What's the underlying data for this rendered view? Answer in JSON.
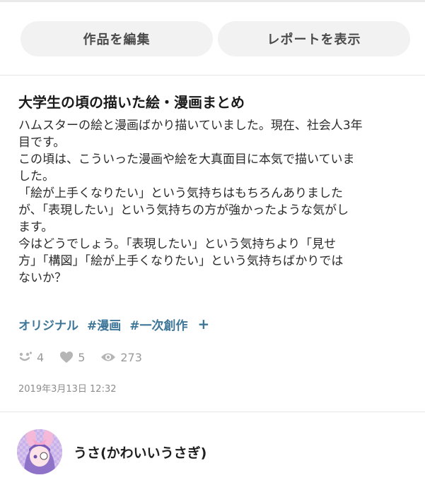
{
  "actions": {
    "edit_label": "作品を編集",
    "report_label": "レポートを表示"
  },
  "work": {
    "title": "大学生の頃の描いた絵・漫画まとめ",
    "caption_lines": [
      "ハムスターの絵と漫画ばかり描いていました。現在、社会人3年",
      "目です。",
      "この頃は、こういった漫画や絵を大真面目に本気で描いていま",
      "した。",
      "「絵が上手くなりたい」という気持ちはもちろんありました",
      "が、「表現したい」という気持ちの方が強かったような気がし",
      "ます。",
      "今はどうでしょう。「表現したい」という気持ちより「見せ",
      "方」「構図」「絵が上手くなりたい」という気持ちばかりでは",
      "ないか？"
    ],
    "tags": [
      "オリジナル",
      "#漫画",
      "#一次創作"
    ],
    "add_tag_glyph": "+",
    "stats": {
      "reactions": "4",
      "likes": "5",
      "views": "273"
    },
    "date": "2019年3月13日 12:32"
  },
  "author": {
    "name": "うさ(かわいいうさぎ)"
  },
  "icons": {
    "reactions": "smile-reaction-icon",
    "likes": "heart-icon",
    "views": "eye-icon"
  },
  "colors": {
    "tag": "#3d7699",
    "button_bg": "#f2f2f2",
    "muted": "#9a9a9a"
  }
}
